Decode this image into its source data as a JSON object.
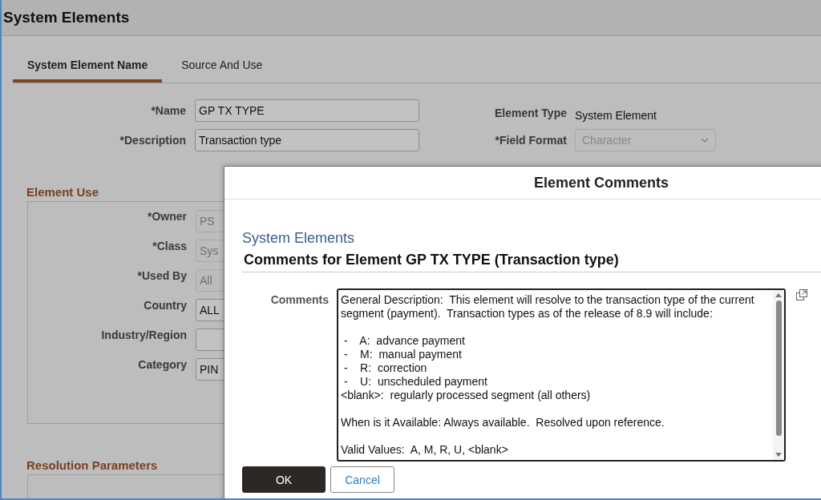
{
  "page_title": "System Elements",
  "tabs": [
    {
      "label": "System Element Name",
      "selected": true
    },
    {
      "label": "Source And Use",
      "selected": false
    }
  ],
  "name_fields": [
    {
      "label": "*Name",
      "value": "GP TX TYPE"
    },
    {
      "label": "*Description",
      "value": "Transaction type"
    }
  ],
  "element_type": {
    "label": "Element Type",
    "value": "System Element"
  },
  "field_format": {
    "label": "*Field Format",
    "value": "Character",
    "disabled": true
  },
  "element_use": {
    "heading": "Element Use",
    "fields": [
      {
        "label": "*Owner",
        "value": "PS",
        "disabled": true
      },
      {
        "label": "*Class",
        "value": "Sys",
        "disabled": true
      },
      {
        "label": "*Used By",
        "value": "All",
        "disabled": true
      },
      {
        "label": "Country",
        "value": "ALL",
        "disabled": false
      },
      {
        "label": "Industry/Region",
        "disabled": false
      },
      {
        "label": "Category",
        "value": "PIN",
        "disabled": false
      }
    ]
  },
  "resolution_parameters": {
    "heading": "Resolution Parameters"
  },
  "dialog": {
    "title": "Element Comments",
    "breadcrumb": "System Elements",
    "heading": "Comments for Element GP TX TYPE (Transaction type)",
    "comments_label": "Comments",
    "comments": "General Description:  This element will resolve to the transaction type of the current segment (payment).  Transaction types as of the release of 8.9 will include:\n\n -    A:  advance payment\n -    M:  manual payment\n -    R:  correction\n -    U:  unscheduled payment\n<blank>:  regularly processed segment (all others)\n\nWhen is it Available: Always available.  Resolved upon reference.\n\nValid Values:  A, M, R, U, <blank>",
    "buttons": [
      {
        "label": "OK",
        "kind": "primary"
      },
      {
        "label": "Cancel",
        "kind": "secondary"
      }
    ]
  }
}
